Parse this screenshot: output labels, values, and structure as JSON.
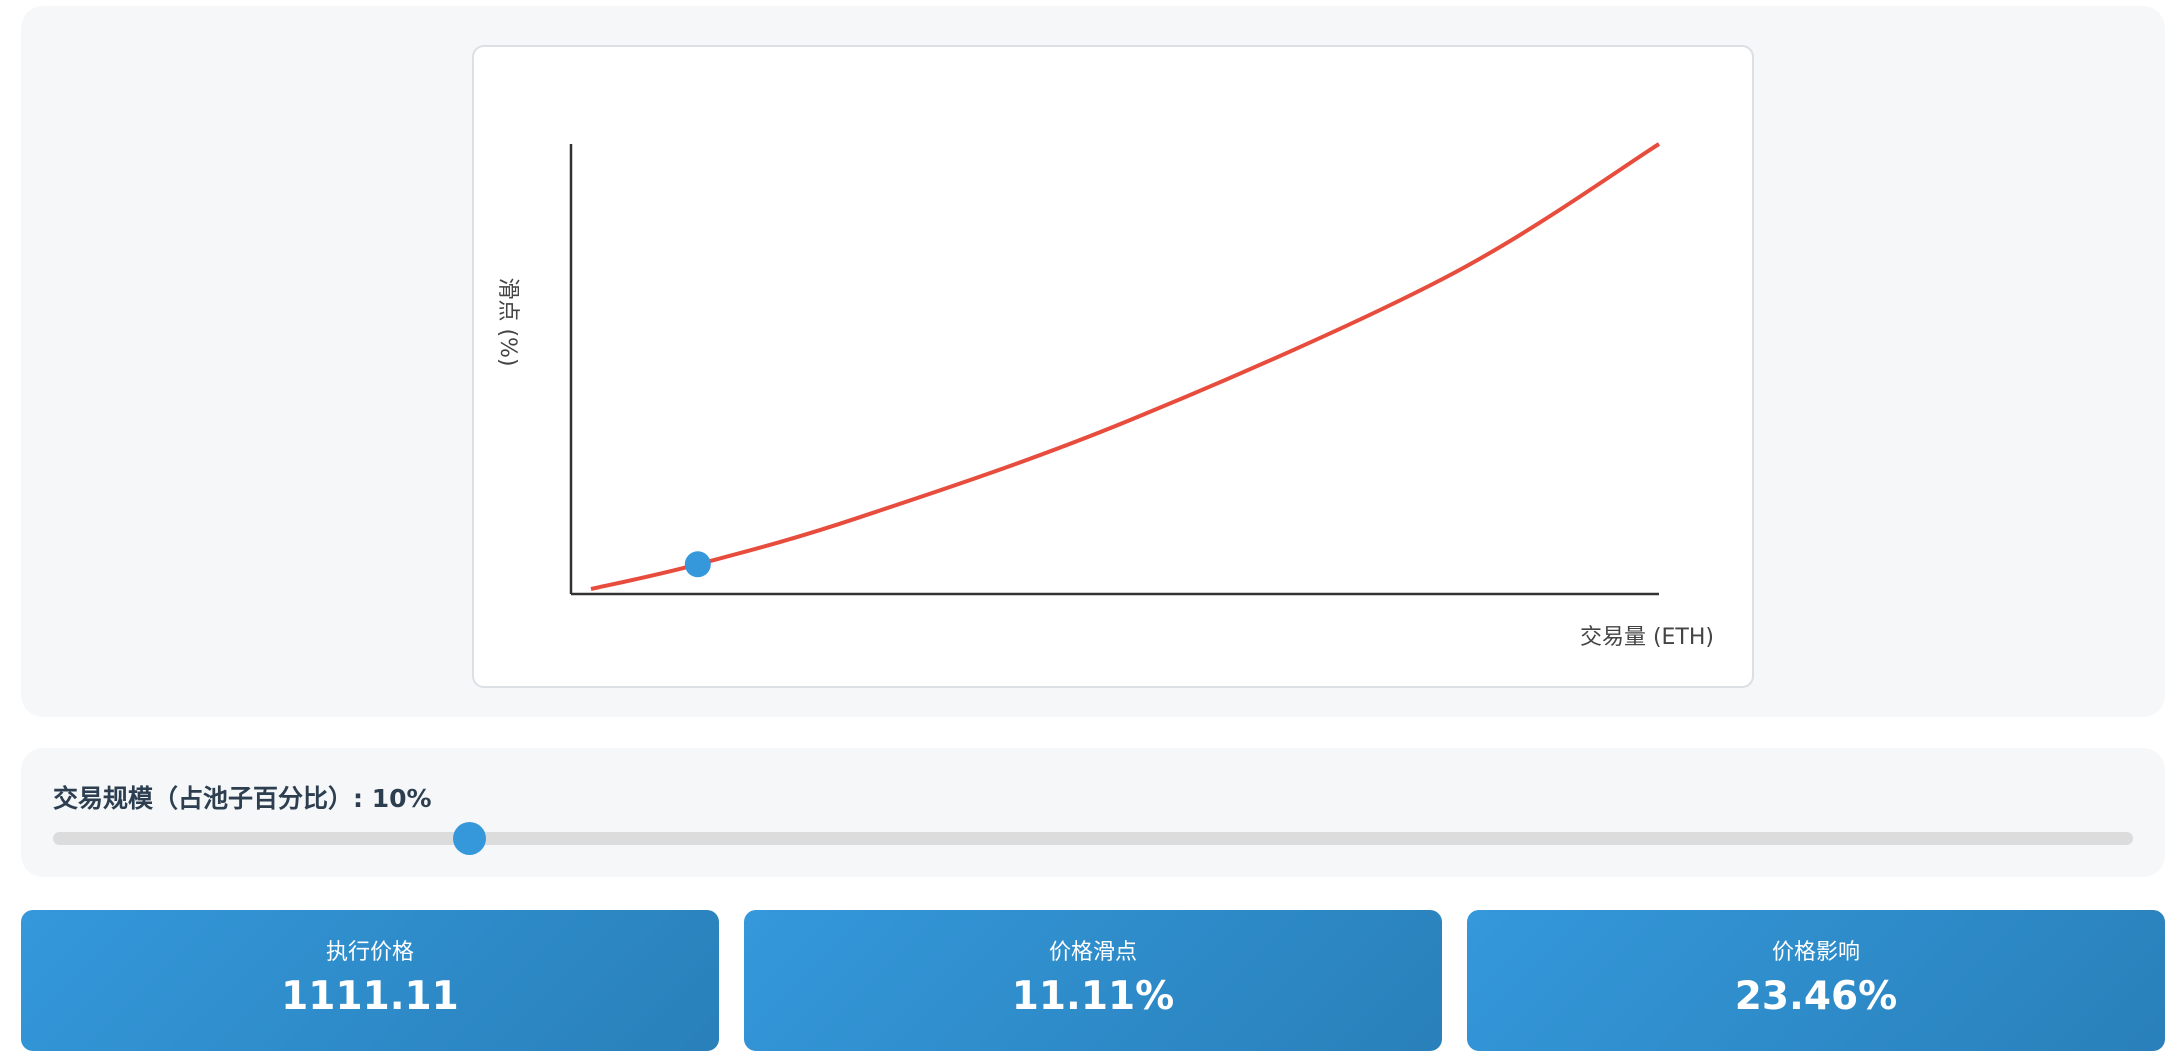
{
  "chart_data": {
    "type": "line",
    "xlabel": "交易量 (ETH)",
    "ylabel": "滑点 (%)",
    "series": [
      {
        "values": [
          [
            0,
            0
          ],
          [
            10,
            11.11
          ],
          [
            25,
            32
          ],
          [
            50,
            75
          ],
          [
            80,
            140
          ],
          [
            100,
            200
          ]
        ],
        "color": "#e74c3c"
      }
    ],
    "marker": {
      "x": 10,
      "y": 11.11,
      "color": "#3498db"
    },
    "grid": false,
    "x_tick_labels": false,
    "y_tick_labels": false
  },
  "slider": {
    "label": "交易规模（占池子百分比）: ",
    "value_text": "10%",
    "value": 10,
    "min": 0,
    "max": 50
  },
  "stats": [
    {
      "label": "执行价格",
      "value": "1111.11"
    },
    {
      "label": "价格滑点",
      "value": "11.11%"
    },
    {
      "label": "价格影响",
      "value": "23.46%"
    }
  ]
}
